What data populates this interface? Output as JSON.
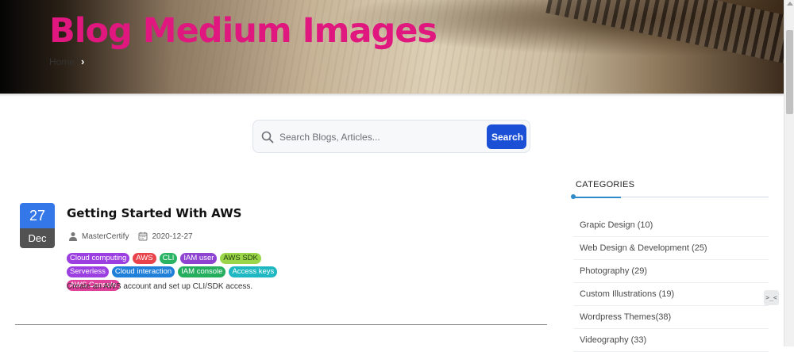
{
  "hero": {
    "title": "Blog Medium Images",
    "breadcrumb": {
      "home": "Home",
      "separator": "›"
    }
  },
  "search": {
    "placeholder": "Search Blogs, Articles...",
    "button_label": "Search"
  },
  "post": {
    "day": "27",
    "month": "Dec",
    "title": "Getting Started With AWS",
    "author": "MasterCertify",
    "date": "2020-12-27",
    "tags": [
      {
        "label": "Cloud computing",
        "color": "#9b3fe0"
      },
      {
        "label": "AWS",
        "color": "#e8434b"
      },
      {
        "label": "CLI",
        "color": "#28b463"
      },
      {
        "label": "IAM user",
        "color": "#8e44d1"
      },
      {
        "label": "AWS SDK",
        "color": "#9bd64a"
      },
      {
        "label": "Serverless",
        "color": "#9b3fe0"
      },
      {
        "label": "Cloud interaction",
        "color": "#1f7fd9"
      },
      {
        "label": "IAM console",
        "color": "#26ae5f"
      },
      {
        "label": "Access keys",
        "color": "#1fb8c2"
      },
      {
        "label": "AWS Console",
        "color": "#e0429b"
      }
    ],
    "excerpt": "Create an AWS account and set up CLI/SDK access."
  },
  "sidebar": {
    "heading": "CATEGORIES",
    "categories": [
      "Grapic Design (10)",
      "Web Design & Development (25)",
      "Photography (29)",
      "Custom Illustrations (19)",
      "Wordpress Themes(38)",
      "Videography (33)"
    ]
  },
  "colors": {
    "brand_pink": "#e0177f",
    "primary_blue": "#1a4fd6",
    "date_blue": "#3477e8"
  }
}
